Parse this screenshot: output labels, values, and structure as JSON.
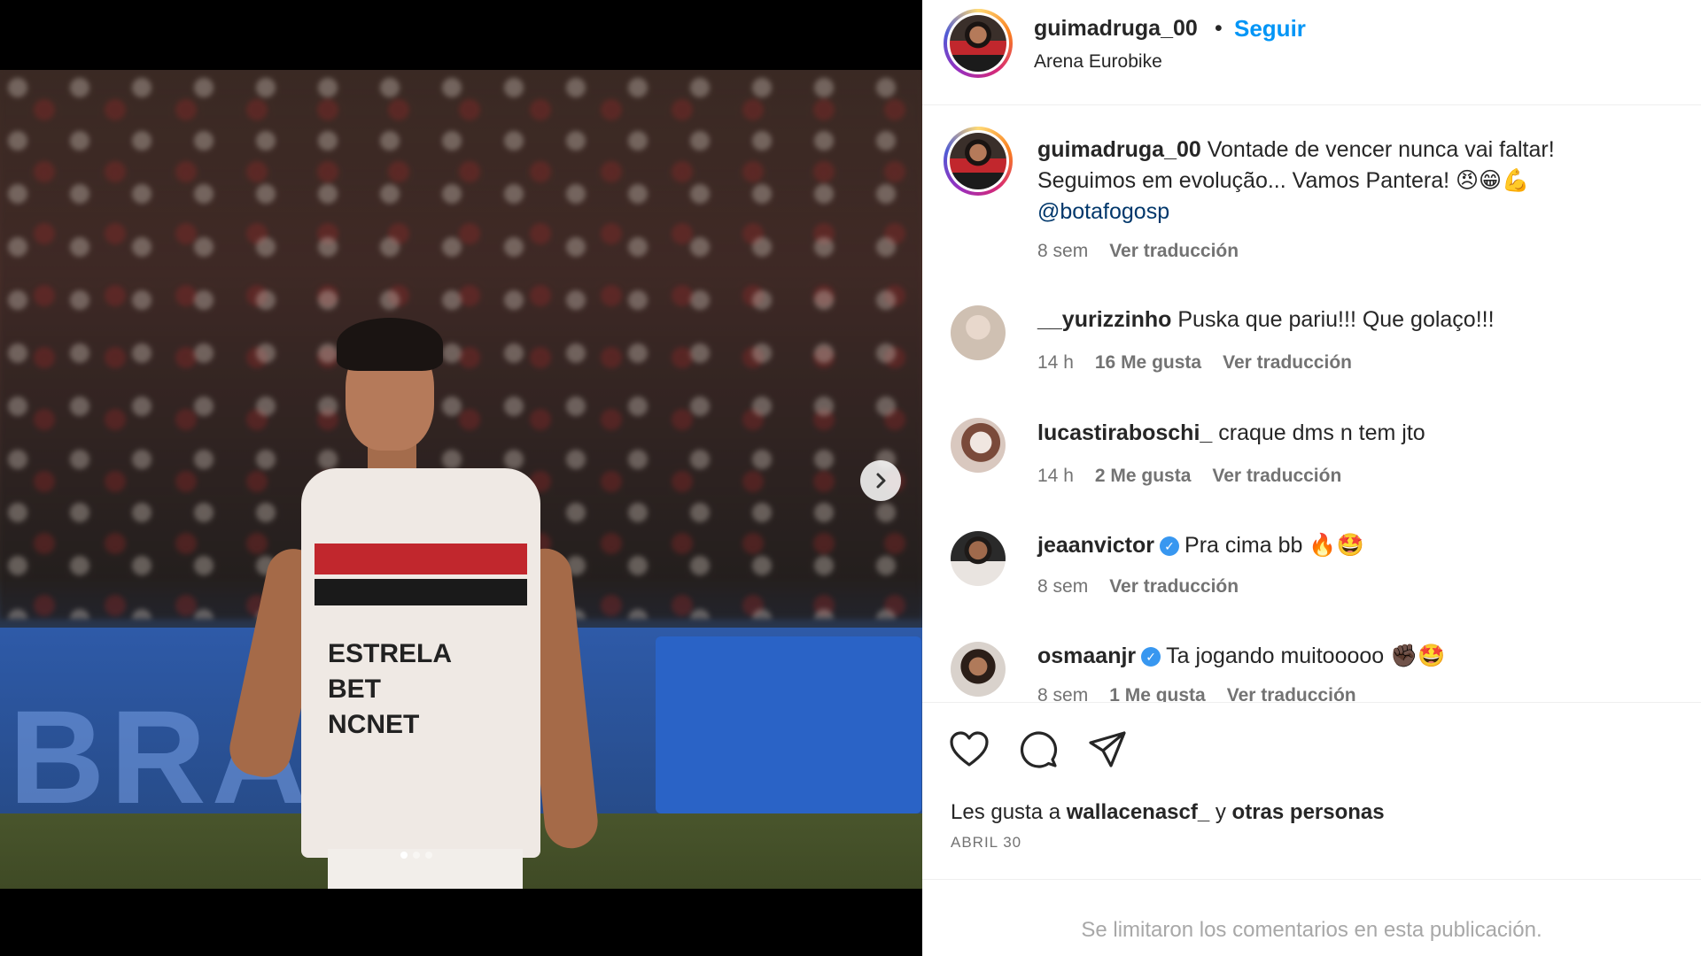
{
  "post": {
    "username": "guimadruga_00",
    "separator": "•",
    "follow_label": "Seguir",
    "location": "Arena Eurobike"
  },
  "media": {
    "banner_text": "BRAX",
    "sponsor_text": "ESTRELA\nBET\nNCNET",
    "carousel_dots": 3,
    "active_dot": 0,
    "next_icon": "chevron-right-icon"
  },
  "caption": {
    "username": "guimadruga_00",
    "text": " Vontade de vencer nunca vai faltar! Seguimos em evolução... Vamos Pantera! 😠😁💪",
    "mention": "@botafogosp",
    "time": "8 sem",
    "translate": "Ver traducción"
  },
  "comments": [
    {
      "username": "__yurizzinho",
      "verified": false,
      "text": "Puska que pariu!!! Que golaço!!!",
      "time": "14 h",
      "likes": "16 Me gusta",
      "translate": "Ver traducción"
    },
    {
      "username": "lucastiraboschi_",
      "verified": false,
      "text": "craque dms n tem jto",
      "time": "14 h",
      "likes": "2 Me gusta",
      "translate": "Ver traducción"
    },
    {
      "username": "jeaanvictor",
      "verified": true,
      "text": "Pra cima bb 🔥🤩",
      "time": "8 sem",
      "likes": "",
      "translate": "Ver traducción"
    },
    {
      "username": "osmaanjr",
      "verified": true,
      "text": "Ta jogando muitooooo ✊🏿🤩",
      "time": "8 sem",
      "likes": "1 Me gusta",
      "translate": "Ver traducción"
    }
  ],
  "actions": {
    "like_icon": "heart-icon",
    "comment_icon": "comment-icon",
    "share_icon": "send-icon",
    "likes_prefix": "Les gusta a ",
    "likes_user": "wallacenascf_",
    "likes_mid": " y ",
    "likes_rest": "otras personas",
    "date": "ABRIL 30"
  },
  "footer": {
    "limited_text": "Se limitaron los comentarios en esta publicación."
  },
  "colors": {
    "link": "#0095f6",
    "verified": "#3897f0",
    "muted": "#737373"
  }
}
